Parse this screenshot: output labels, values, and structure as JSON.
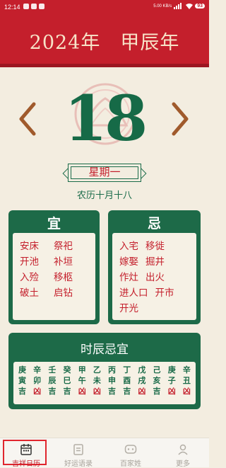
{
  "status_bar": {
    "time": "12:14",
    "network": "5.00 KB/s",
    "battery": "93"
  },
  "header": {
    "year_title": "2024年　甲辰年"
  },
  "date": {
    "day": "18",
    "weekday": "星期一",
    "lunar": "农历十月十八"
  },
  "yi": {
    "title": "宜",
    "items": [
      "安床",
      "祭祀",
      "开池",
      "补垣",
      "入殓",
      "移柩",
      "破土",
      "启钻"
    ]
  },
  "ji": {
    "title": "忌",
    "items": [
      "入宅",
      "移徙",
      "嫁娶",
      "掘井",
      "作灶",
      "出火",
      "进人口",
      "开市",
      "开光"
    ]
  },
  "shichen": {
    "title": "时辰忌宜",
    "columns": [
      {
        "g": "庚",
        "z": "寅",
        "l": "吉"
      },
      {
        "g": "辛",
        "z": "卯",
        "l": "凶"
      },
      {
        "g": "壬",
        "z": "辰",
        "l": "吉"
      },
      {
        "g": "癸",
        "z": "巳",
        "l": "吉"
      },
      {
        "g": "甲",
        "z": "午",
        "l": "凶"
      },
      {
        "g": "乙",
        "z": "未",
        "l": "凶"
      },
      {
        "g": "丙",
        "z": "申",
        "l": "吉"
      },
      {
        "g": "丁",
        "z": "酉",
        "l": "吉"
      },
      {
        "g": "戊",
        "z": "戌",
        "l": "凶"
      },
      {
        "g": "己",
        "z": "亥",
        "l": "吉"
      },
      {
        "g": "庚",
        "z": "子",
        "l": "凶"
      },
      {
        "g": "辛",
        "z": "丑",
        "l": "凶"
      }
    ]
  },
  "colors": {
    "brand_red": "#c41f2c",
    "brand_green": "#1d6a48",
    "paper": "#f3ede0"
  },
  "tabs": [
    {
      "label": "吉祥日历",
      "icon": "calendar-icon",
      "active": true
    },
    {
      "label": "好运语录",
      "icon": "document-icon",
      "active": false
    },
    {
      "label": "百家姓",
      "icon": "chat-bubble-icon",
      "active": false
    },
    {
      "label": "更多",
      "icon": "person-icon",
      "active": false
    }
  ]
}
